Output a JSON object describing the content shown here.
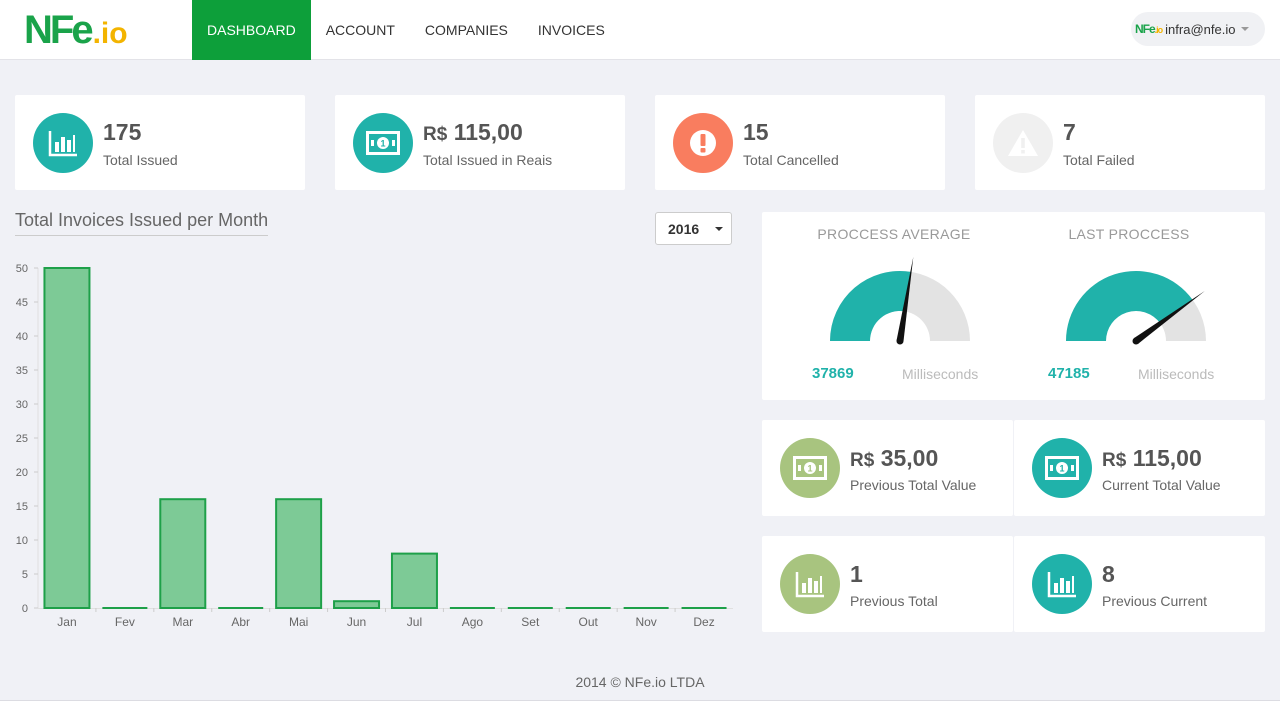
{
  "brand": {
    "logo_main": "NFe",
    "logo_suffix": ".io",
    "accent": "#0d9f3a",
    "teal": "#20b2aa"
  },
  "nav": {
    "items": [
      {
        "label": "DASHBOARD",
        "active": true
      },
      {
        "label": "ACCOUNT"
      },
      {
        "label": "COMPANIES"
      },
      {
        "label": "INVOICES"
      }
    ],
    "user_email": "infra@nfe.io"
  },
  "stats": [
    {
      "value": "175",
      "label": "Total Issued",
      "icon": "bar-chart-icon"
    },
    {
      "currency": "R$",
      "value": "115,00",
      "label": "Total Issued in Reais",
      "icon": "money-icon"
    },
    {
      "value": "15",
      "label": "Total Cancelled",
      "icon": "exclamation-icon"
    },
    {
      "value": "7",
      "label": "Total Failed",
      "icon": "warning-icon"
    }
  ],
  "chart": {
    "title": "Total Invoices Issued per Month",
    "year": "2016"
  },
  "chart_data": {
    "type": "bar",
    "categories": [
      "Jan",
      "Fev",
      "Mar",
      "Abr",
      "Mai",
      "Jun",
      "Jul",
      "Ago",
      "Set",
      "Out",
      "Nov",
      "Dez"
    ],
    "values": [
      50,
      0,
      16,
      0,
      16,
      1,
      8,
      0,
      0,
      0,
      0,
      0
    ],
    "title": "Total Invoices Issued per Month",
    "xlabel": "",
    "ylabel": "",
    "ylim": [
      0,
      50
    ],
    "yticks": [
      0,
      5,
      10,
      15,
      20,
      25,
      30,
      35,
      40,
      45,
      50
    ],
    "grid": false,
    "colors": {
      "fill": "#7dca96",
      "stroke": "#1ea049"
    }
  },
  "gauges": [
    {
      "title": "PROCCESS AVERAGE",
      "value": "37869",
      "unit": "Milliseconds",
      "needle_fraction": 0.55
    },
    {
      "title": "LAST PROCCESS",
      "value": "47185",
      "unit": "Milliseconds",
      "needle_fraction": 0.8
    }
  ],
  "value_cards": [
    {
      "currency": "R$",
      "value": "35,00",
      "label": "Previous Total Value",
      "icon": "money-icon",
      "color": "#a8c47f"
    },
    {
      "currency": "R$",
      "value": "115,00",
      "label": "Current Total Value",
      "icon": "money-icon",
      "color": "#20b2aa"
    },
    {
      "value": "1",
      "label": "Previous Total",
      "icon": "bar-chart-icon",
      "color": "#a8c47f"
    },
    {
      "value": "8",
      "label": "Previous Current",
      "icon": "bar-chart-icon",
      "color": "#20b2aa"
    }
  ],
  "footer": "2014 © NFe.io LTDA"
}
